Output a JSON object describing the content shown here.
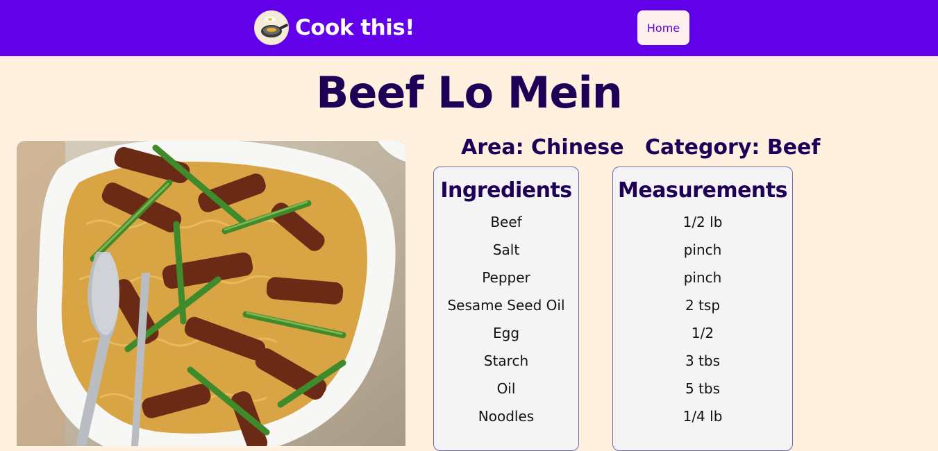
{
  "header": {
    "brand": "Cook this!",
    "logo_icon": "frying-pan-icon",
    "nav": {
      "home_label": "Home"
    }
  },
  "recipe": {
    "title": "Beef Lo Mein",
    "image_alt": "Beef Lo Mein dish photo",
    "area_label": "Area: Chinese",
    "category_label": "Category: Beef",
    "ingredients_heading": "Ingredients",
    "measurements_heading": "Measurements",
    "ingredients": [
      "Beef",
      "Salt",
      "Pepper",
      "Sesame Seed Oil",
      "Egg",
      "Starch",
      "Oil",
      "Noodles"
    ],
    "measurements": [
      "1/2 lb",
      "pinch",
      "pinch",
      "2 tsp",
      "1/2",
      "3 tbs",
      "5 tbs",
      "1/4 lb"
    ]
  },
  "colors": {
    "nav_bg": "#6200ea",
    "page_bg": "#fff0df",
    "heading": "#1f0057",
    "panel_bg": "#f4f4f4",
    "panel_border": "#7066b0"
  }
}
